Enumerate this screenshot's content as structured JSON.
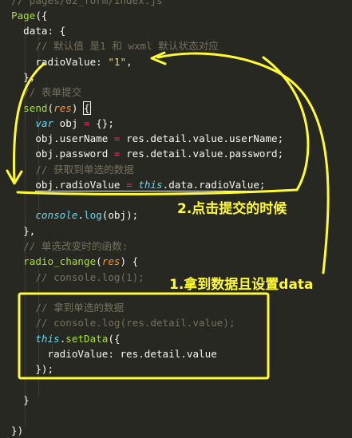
{
  "editor": {
    "lines": [
      "// pages/02_form/index.js",
      "Page({",
      "  data: {",
      "    // 默认值 是1 和 wxml 默认状态对应",
      "    radioValue: \"1\",",
      "  },",
      "  // 表单提交",
      "  send(res) {",
      "    var obj = {};",
      "    obj.userName = res.detail.value.userName;",
      "    obj.password = res.detail.value.password;",
      "    // 获取到单选的数据",
      "    obj.radioValue = this.data.radioValue;",
      "",
      "    console.log(obj);",
      "  },",
      "  // 单选改变时的函数:",
      "  radio_change(res) {",
      "    // console.log(1);",
      "",
      "    // 拿到单选的数据",
      "    // console.log(res.detail.value);",
      "    this.setData({",
      "      radioValue: res.detail.value",
      "    });",
      "",
      "  }",
      "",
      "})"
    ]
  },
  "annotations": {
    "step2": "2.点击提交的时候",
    "step1": "1.拿到数据且设置data"
  },
  "colors": {
    "background": "#272822",
    "annotation": "#fffb33",
    "comment": "#75715e",
    "string": "#e6db74",
    "function": "#a6e22e",
    "keyword": "#f92672",
    "storage": "#66d9ef",
    "parameter": "#fd971f"
  }
}
